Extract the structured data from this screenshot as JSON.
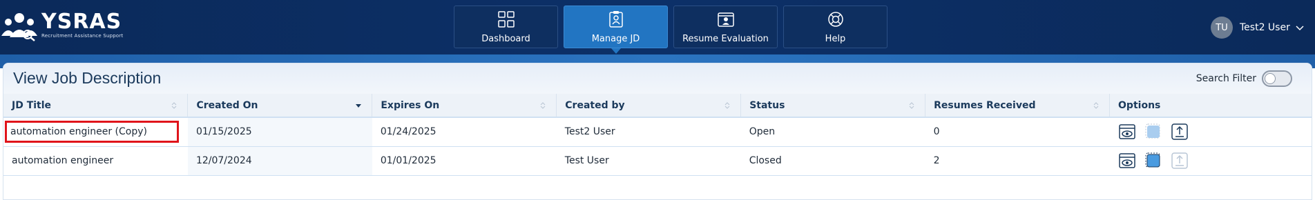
{
  "app": {
    "name": "YSRAS",
    "subtitle": "Recruitment Assistance Support"
  },
  "nav": [
    {
      "label": "Dashboard",
      "icon": "grid-icon",
      "active": false
    },
    {
      "label": "Manage JD",
      "icon": "clipboard-icon",
      "active": true
    },
    {
      "label": "Resume Evaluation",
      "icon": "id-card-icon",
      "active": false
    },
    {
      "label": "Help",
      "icon": "lifebuoy-icon",
      "active": false
    }
  ],
  "user": {
    "initials": "TU",
    "name": "Test2 User"
  },
  "page": {
    "title": "View Job Description",
    "search_filter_label": "Search Filter",
    "search_filter_on": false
  },
  "table": {
    "columns": [
      "JD Title",
      "Created On",
      "Expires On",
      "Created by",
      "Status",
      "Resumes Received",
      "Options"
    ],
    "rows": [
      {
        "title": "automation engineer (Copy)",
        "created_on": "01/15/2025",
        "expires_on": "01/24/2025",
        "created_by": "Test2 User",
        "status": "Open",
        "resumes": "0"
      },
      {
        "title": "automation engineer",
        "created_on": "12/07/2024",
        "expires_on": "01/01/2025",
        "created_by": "Test User",
        "status": "Closed",
        "resumes": "2"
      }
    ]
  },
  "colors": {
    "header_bg": "#0b2a5a",
    "nav_active": "#2275c2",
    "highlight": "#e0141b"
  }
}
